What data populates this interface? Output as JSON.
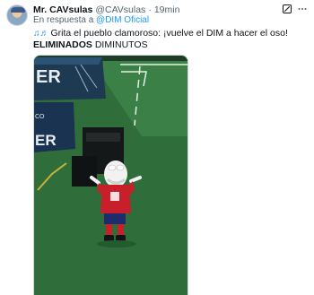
{
  "author": {
    "name": "Mr. CAVsulas",
    "handle": "@CAVsulas",
    "separator": "·",
    "time": "19min"
  },
  "reply": {
    "prefix": "En respuesta a",
    "mention": "@DIM Oficial"
  },
  "tweet": {
    "line1": "Grita el pueblo clamoroso: ¡vuelve el DIM a hacer el oso!",
    "line2_bold": "ELIMINADOS",
    "line2_rest": "DIMINUTOS"
  },
  "icons": {
    "avatar": "user-avatar",
    "grok": "grok-icon",
    "more": "more-icon",
    "notes": "music-notes-emoji"
  },
  "media": {
    "banner_text": "ER",
    "banner_text_lower": "ER",
    "banner_small": "CO"
  },
  "colors": {
    "link": "#1d9bf0",
    "muted": "#536471",
    "pitch": "#2f6e3b",
    "mascot_shirt": "#c8202a"
  }
}
